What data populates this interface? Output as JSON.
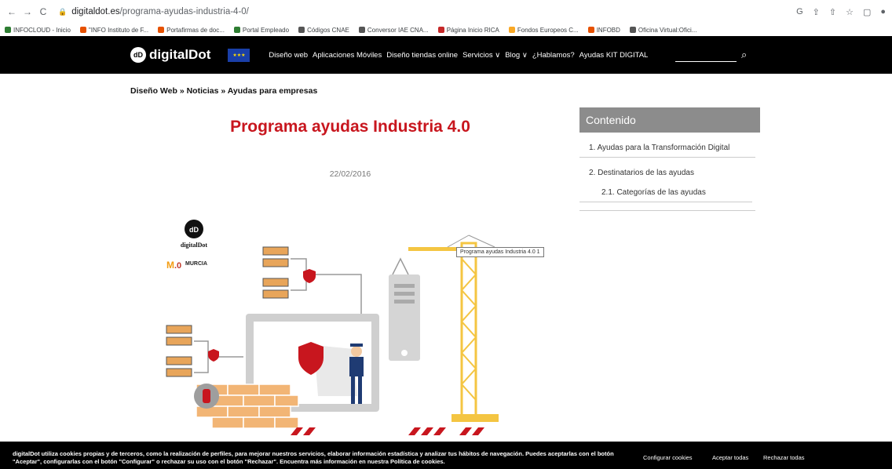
{
  "browser": {
    "url_host": "digitaldot.es",
    "url_path": "/programa-ayudas-industria-4-0/",
    "bookmarks": [
      {
        "label": "INFOCLOUD - Inicio",
        "color": "#2e7d32"
      },
      {
        "label": "\"INFO Instituto de F...",
        "color": "#e65100"
      },
      {
        "label": "Portafirmas de doc...",
        "color": "#e65100"
      },
      {
        "label": "Portal Empleado",
        "color": "#2e7d32"
      },
      {
        "label": "Códigos CNAE",
        "color": "#555555"
      },
      {
        "label": "Conversor IAE CNA...",
        "color": "#555555"
      },
      {
        "label": "Página Inicio RICA",
        "color": "#c62828"
      },
      {
        "label": "Fondos Europeos C...",
        "color": "#f9a825"
      },
      {
        "label": "INFOBD",
        "color": "#e65100"
      },
      {
        "label": "Oficina Virtual:Ofici...",
        "color": "#555555"
      }
    ]
  },
  "header": {
    "logo_text": "digitalDot",
    "logo_mark": "dD",
    "menu": [
      "Diseño web",
      "Aplicaciones Móviles",
      "Diseño tiendas online",
      "Servicios ∨",
      "Blog ∨",
      "¿Hablamos?",
      "Ayudas KIT DIGITAL"
    ]
  },
  "breadcrumb": "Diseño Web » Noticias » Ayudas para empresas",
  "article": {
    "title": "Programa ayudas Industria 4.0",
    "date": "22/02/2016",
    "image_tooltip": "Programa ayudas Industria 4.0 1",
    "image_logo_text": "digitalDot",
    "image_murcia_text": "MURCIA"
  },
  "toc": {
    "heading": "Contenido",
    "items": [
      "1. Ayudas para la Transformación Digital",
      "2. Destinatarios de las ayudas",
      "2.1. Categorías de las ayudas"
    ]
  },
  "cookie": {
    "text": "digitalDot utiliza cookies propias y de terceros, como la realización de perfiles, para mejorar nuestros servicios, elaborar información estadística y analizar tus hábitos de navegación. Puedes aceptarlas con el botón \"Aceptar\", configurarlas con el botón \"Configurar\" o rechazar su uso con el botón \"Rechazar\". Encuentra más información en nuestra Política de cookies.",
    "configure": "Configurar cookies",
    "accept": "Aceptar todas",
    "reject": "Rechazar todas"
  },
  "colors": {
    "accent": "#c8161e",
    "toc_bg": "#8c8c8c",
    "crane": "#f4c542"
  }
}
